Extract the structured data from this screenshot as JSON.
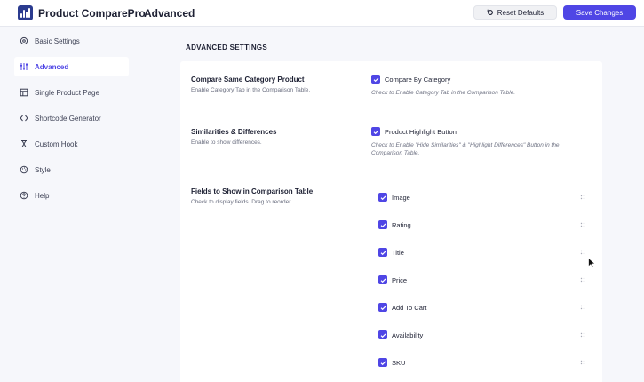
{
  "app": {
    "name": "Product ComparePro",
    "page_title": "Advanced"
  },
  "toolbar": {
    "reset_label": "Reset Defaults",
    "save_label": "Save Changes"
  },
  "colors": {
    "accent": "#4f46e5",
    "logo": "#2b3b8f"
  },
  "sidebar": {
    "items": [
      {
        "label": "Basic Settings",
        "icon": "gear-icon",
        "active": false
      },
      {
        "label": "Advanced",
        "icon": "sliders-icon",
        "active": true
      },
      {
        "label": "Single Product Page",
        "icon": "page-icon",
        "active": false
      },
      {
        "label": "Shortcode Generator",
        "icon": "code-icon",
        "active": false
      },
      {
        "label": "Custom Hook",
        "icon": "hook-icon",
        "active": false
      },
      {
        "label": "Style",
        "icon": "palette-icon",
        "active": false
      },
      {
        "label": "Help",
        "icon": "help-icon",
        "active": false
      }
    ]
  },
  "section": {
    "title": "ADVANCED SETTINGS"
  },
  "settings": {
    "compare_category": {
      "title": "Compare Same Category Product",
      "desc": "Enable Category Tab in the Comparison Table.",
      "checkbox_label": "Compare By Category",
      "checked": true,
      "help": "Check to Enable Category Tab in the Comparison Table."
    },
    "similarities": {
      "title": "Similarities & Differences",
      "desc": "Enable to show differences.",
      "checkbox_label": "Product Highlight Button",
      "checked": true,
      "help_line1": "Check to Enable \"Hide Similarities\" & \"Highlight Differences\" Button in the",
      "help_line2": "Comparison Table."
    },
    "fields": {
      "title": "Fields to Show in Comparison Table",
      "desc": "Check to display fields. Drag to reorder.",
      "items": [
        {
          "label": "Image",
          "checked": true
        },
        {
          "label": "Rating",
          "checked": true
        },
        {
          "label": "Title",
          "checked": true
        },
        {
          "label": "Price",
          "checked": true
        },
        {
          "label": "Add To Cart",
          "checked": true
        },
        {
          "label": "Availability",
          "checked": true
        },
        {
          "label": "SKU",
          "checked": true
        }
      ]
    }
  }
}
